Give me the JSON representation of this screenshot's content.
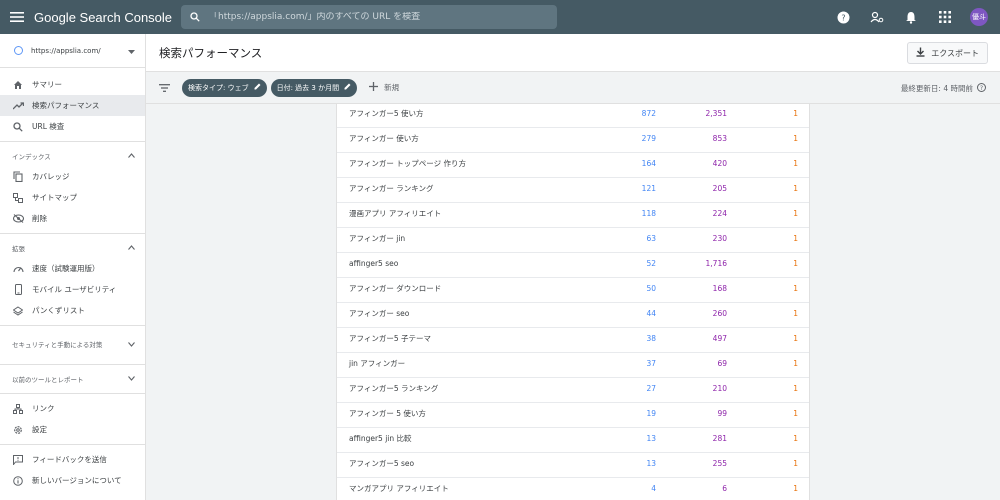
{
  "app": {
    "title": "Google Search Console"
  },
  "search": {
    "placeholder": "「https://appslia.com/」内のすべての URL を検査"
  },
  "avatar": {
    "label": "優斗",
    "color": "#7e57c2"
  },
  "property": {
    "label": "https://appslia.com/"
  },
  "sidebar": {
    "items": [
      {
        "label": "サマリー",
        "icon": "home-icon"
      },
      {
        "label": "検索パフォーマンス",
        "icon": "trending-up-icon",
        "active": true
      },
      {
        "label": "URL 検査",
        "icon": "search-icon"
      }
    ],
    "index_section": "インデックス",
    "index_items": [
      {
        "label": "カバレッジ",
        "icon": "copy-icon"
      },
      {
        "label": "サイトマップ",
        "icon": "sitemap-icon"
      },
      {
        "label": "削除",
        "icon": "visibility-off-icon"
      }
    ],
    "enhance_section": "拡張",
    "enhance_items": [
      {
        "label": "速度（試験運用版）",
        "icon": "speed-icon"
      },
      {
        "label": "モバイル ユーザビリティ",
        "icon": "smartphone-icon"
      },
      {
        "label": "パンくずリスト",
        "icon": "layers-icon"
      }
    ],
    "security_section": "セキュリティと手動による対策",
    "legacy_section": "以前のツールとレポート",
    "bottom_items": [
      {
        "label": "リンク",
        "icon": "links-icon"
      },
      {
        "label": "設定",
        "icon": "settings-icon"
      },
      {
        "label": "フィードバックを送信",
        "icon": "feedback-icon"
      },
      {
        "label": "新しいバージョンについて",
        "icon": "info-icon"
      }
    ]
  },
  "header": {
    "title": "検索パフォーマンス",
    "export_label": "エクスポート"
  },
  "filters": {
    "chips": [
      {
        "label": "検索タイプ: ウェブ"
      },
      {
        "label": "日付: 過去 3 か月間"
      }
    ],
    "new_label": "新規",
    "updated": "最終更新日: 4 時間前"
  },
  "colors": {
    "topbar": "#455a64",
    "clicks": "#4285f4",
    "impressions": "#8e24aa",
    "position": "#e8710a"
  },
  "table": {
    "rows": [
      {
        "query": "アフィンガー5 使い方",
        "clicks": "872",
        "impressions": "2,351",
        "position": "1"
      },
      {
        "query": "アフィンガー 使い方",
        "clicks": "279",
        "impressions": "853",
        "position": "1"
      },
      {
        "query": "アフィンガー トップページ 作り方",
        "clicks": "164",
        "impressions": "420",
        "position": "1"
      },
      {
        "query": "アフィンガー ランキング",
        "clicks": "121",
        "impressions": "205",
        "position": "1"
      },
      {
        "query": "漫画アプリ アフィリエイト",
        "clicks": "118",
        "impressions": "224",
        "position": "1"
      },
      {
        "query": "アフィンガー jin",
        "clicks": "63",
        "impressions": "230",
        "position": "1"
      },
      {
        "query": "affinger5 seo",
        "clicks": "52",
        "impressions": "1,716",
        "position": "1"
      },
      {
        "query": "アフィンガー ダウンロード",
        "clicks": "50",
        "impressions": "168",
        "position": "1"
      },
      {
        "query": "アフィンガー seo",
        "clicks": "44",
        "impressions": "260",
        "position": "1"
      },
      {
        "query": "アフィンガー5 子テーマ",
        "clicks": "38",
        "impressions": "497",
        "position": "1"
      },
      {
        "query": "jin アフィンガー",
        "clicks": "37",
        "impressions": "69",
        "position": "1"
      },
      {
        "query": "アフィンガー5 ランキング",
        "clicks": "27",
        "impressions": "210",
        "position": "1"
      },
      {
        "query": "アフィンガー 5 使い方",
        "clicks": "19",
        "impressions": "99",
        "position": "1"
      },
      {
        "query": "affinger5 jin 比較",
        "clicks": "13",
        "impressions": "281",
        "position": "1"
      },
      {
        "query": "アフィンガー5 seo",
        "clicks": "13",
        "impressions": "255",
        "position": "1"
      },
      {
        "query": "マンガアプリ アフィリエイト",
        "clicks": "4",
        "impressions": "6",
        "position": "1"
      }
    ]
  }
}
